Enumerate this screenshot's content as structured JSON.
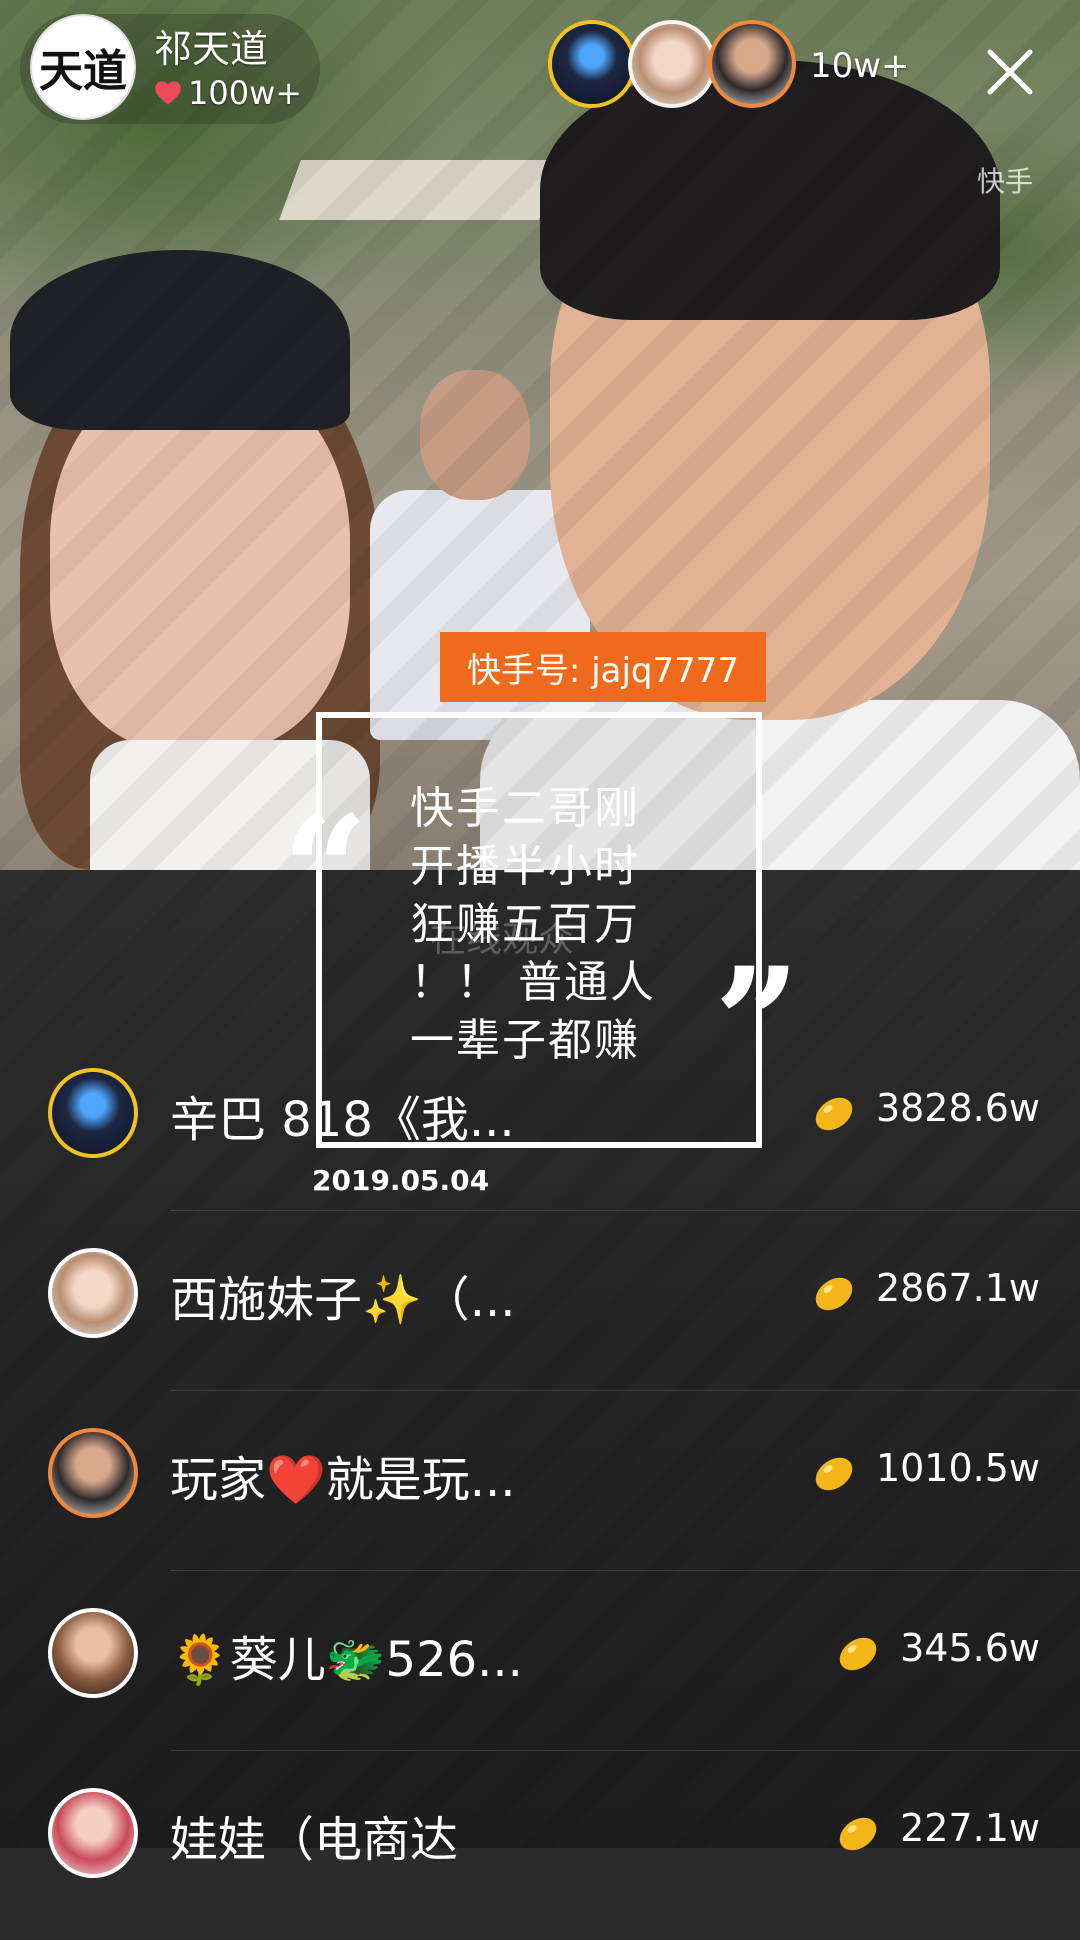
{
  "host": {
    "name": "祁天道",
    "likes": "100w+",
    "avatar_glyph": "天道"
  },
  "viewers": {
    "count": "10w+"
  },
  "brand_watermark": "快手",
  "overlay": {
    "id_badge": "快手号: jajq7777",
    "quote_lines": [
      "快手二哥刚",
      "开播半小时",
      "狂赚五百万",
      "！！ 普通人",
      "一辈子都赚"
    ],
    "ghost_text": "在线观众",
    "date": "2019.05.04",
    "badge_color": "#f06a1e"
  },
  "ranking": [
    {
      "name": "辛巴 818《我...",
      "value": "3828.6w",
      "avatar_border": "#f3c21f"
    },
    {
      "name": "西施妹子✨（...",
      "value": "2867.1w",
      "avatar_border": "#ffffff"
    },
    {
      "name": "玩家❤️就是玩...",
      "value": "1010.5w",
      "avatar_border": "#f08a3a"
    },
    {
      "name": "🌻葵儿🐲526...",
      "value": "345.6w",
      "avatar_border": "#ffffff"
    },
    {
      "name": "娃娃（电商达",
      "value": "227.1w",
      "avatar_border": "#ffffff"
    }
  ],
  "icons": {
    "heart": "heart-icon",
    "close": "close-icon",
    "bean": "bean-icon"
  },
  "colors": {
    "bean": "#f5b61a",
    "heart": "#f04a5a"
  }
}
